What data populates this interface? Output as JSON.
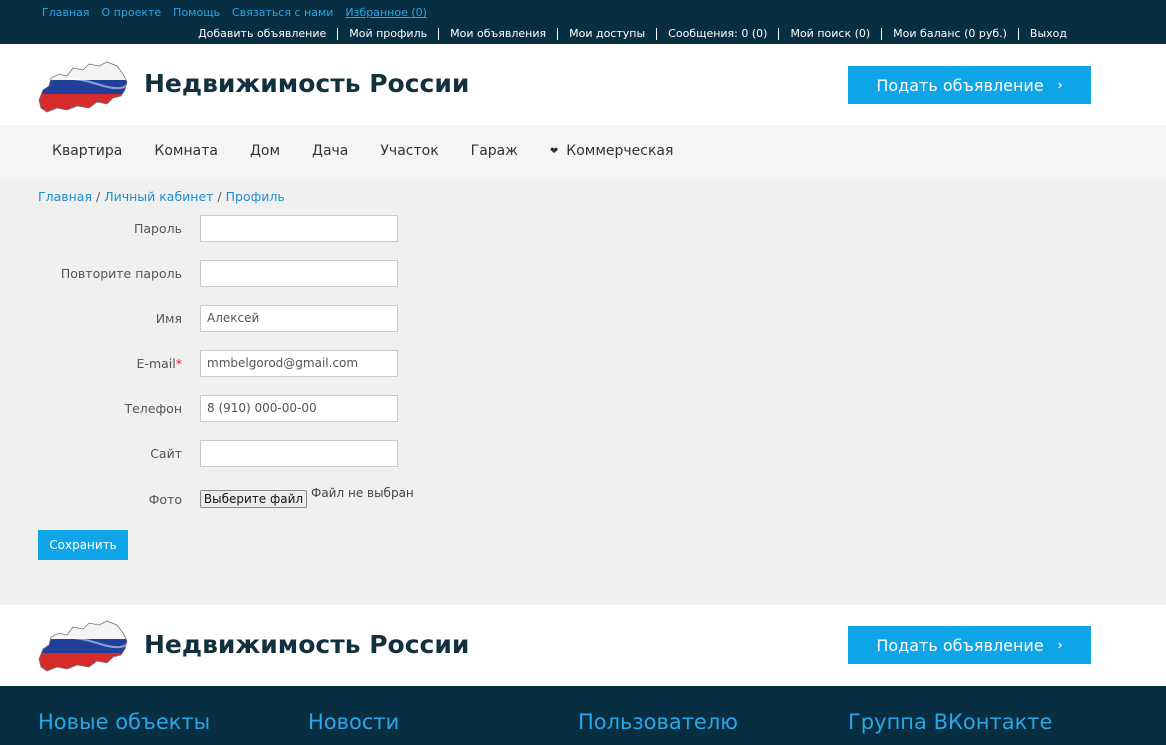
{
  "topbar": {
    "links": [
      "Главная",
      "О проекте",
      "Помощь",
      "Связаться с нами",
      "Избранное (0)"
    ],
    "user_menu": [
      "Добавить объявление",
      "Мой профиль",
      "Мои объявления",
      "Мои доступы",
      "Сообщения: 0 (0)",
      "Мой поиск (0)",
      "Мои баланс (0 руб.)",
      "Выход"
    ]
  },
  "header": {
    "site_title": "Недвижимость России",
    "cta_label": "Подать объявление",
    "cta_icon": "chevron-right-icon",
    "logo_icon": "russia-flag-map-icon"
  },
  "nav": {
    "items": [
      "Квартира",
      "Комната",
      "Дом",
      "Дача",
      "Участок",
      "Гараж"
    ],
    "dropdown_label": "Коммерческая",
    "dropdown_icon": "chevron-down-icon"
  },
  "breadcrumb": {
    "items": [
      "Главная",
      "Личный кабинет",
      "Профиль"
    ],
    "separator": "/"
  },
  "form": {
    "password_label": "Пароль",
    "password_value": "",
    "repeat_password_label": "Повторите пароль",
    "repeat_password_value": "",
    "name_label": "Имя",
    "name_value": "Алексей",
    "email_label": "E-mail",
    "email_required_mark": "*",
    "email_value": "mmbelgorod@gmail.com",
    "phone_label": "Телефон",
    "phone_value": "8 (910) 000-00-00",
    "site_label": "Сайт",
    "site_value": "",
    "photo_label": "Фото",
    "file_button_label": "Выберите файл",
    "file_status": "Файл не выбран",
    "save_label": "Сохранить"
  },
  "footer": {
    "columns": [
      "Новые объекты",
      "Новости",
      "Пользователю",
      "Группа ВКонтакте"
    ]
  },
  "colors": {
    "dark_bar": "#072e41",
    "accent": "#0ea5e9",
    "link": "#2ba6e6"
  }
}
